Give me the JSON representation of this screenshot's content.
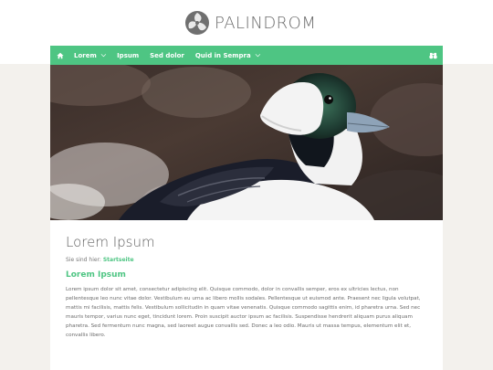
{
  "brand": {
    "name": "PALINDROM",
    "logo_icon": "triskelion-logo-icon"
  },
  "nav": {
    "home_icon": "home-icon",
    "items": [
      {
        "label": "Lorem",
        "dropdown": true
      },
      {
        "label": "Ipsum",
        "dropdown": false
      },
      {
        "label": "Sed dolor",
        "dropdown": false
      },
      {
        "label": "Quid in Sempra",
        "dropdown": true
      }
    ],
    "search_icon": "binoculars-icon",
    "background_color": "#4ec583"
  },
  "hero": {
    "image": "bufflehead-duck-photo"
  },
  "main": {
    "title": "Lorem Ipsum",
    "breadcrumb_prefix": "Sie sind hier:",
    "breadcrumb_link": "Startseite",
    "section_title": "Lorem Ipsum",
    "paragraph": "Lorem ipsum dolor sit amet, consectetur adipiscing elit. Quisque commodo, dolor in convallis semper, eros ex ultricies lectus, non pellentesque leo nunc vitae dolor. Vestibulum eu urna ac libero mollis sodales. Pellentesque ut euismod ante. Praesent nec ligula volutpat, mattis mi facilisis, mattis felis. Vestibulum sollicitudin in quam vitae venenatis. Quisque commodo sagittis enim, id pharetra urna. Sed nec mauris tempor, varius nunc eget, tincidunt lorem. Proin suscipit auctor ipsum ac facilisis. Suspendisse hendrerit aliquam purus aliquam pharetra. Sed fermentum nunc magna, sed laoreet augue convallis sed. Donec a leo odio. Mauris ut massa tempus, elementum elit et, convallis libero."
  },
  "colors": {
    "accent": "#4ec583",
    "page_background": "#f3f1ed",
    "title_text": "#616161"
  }
}
